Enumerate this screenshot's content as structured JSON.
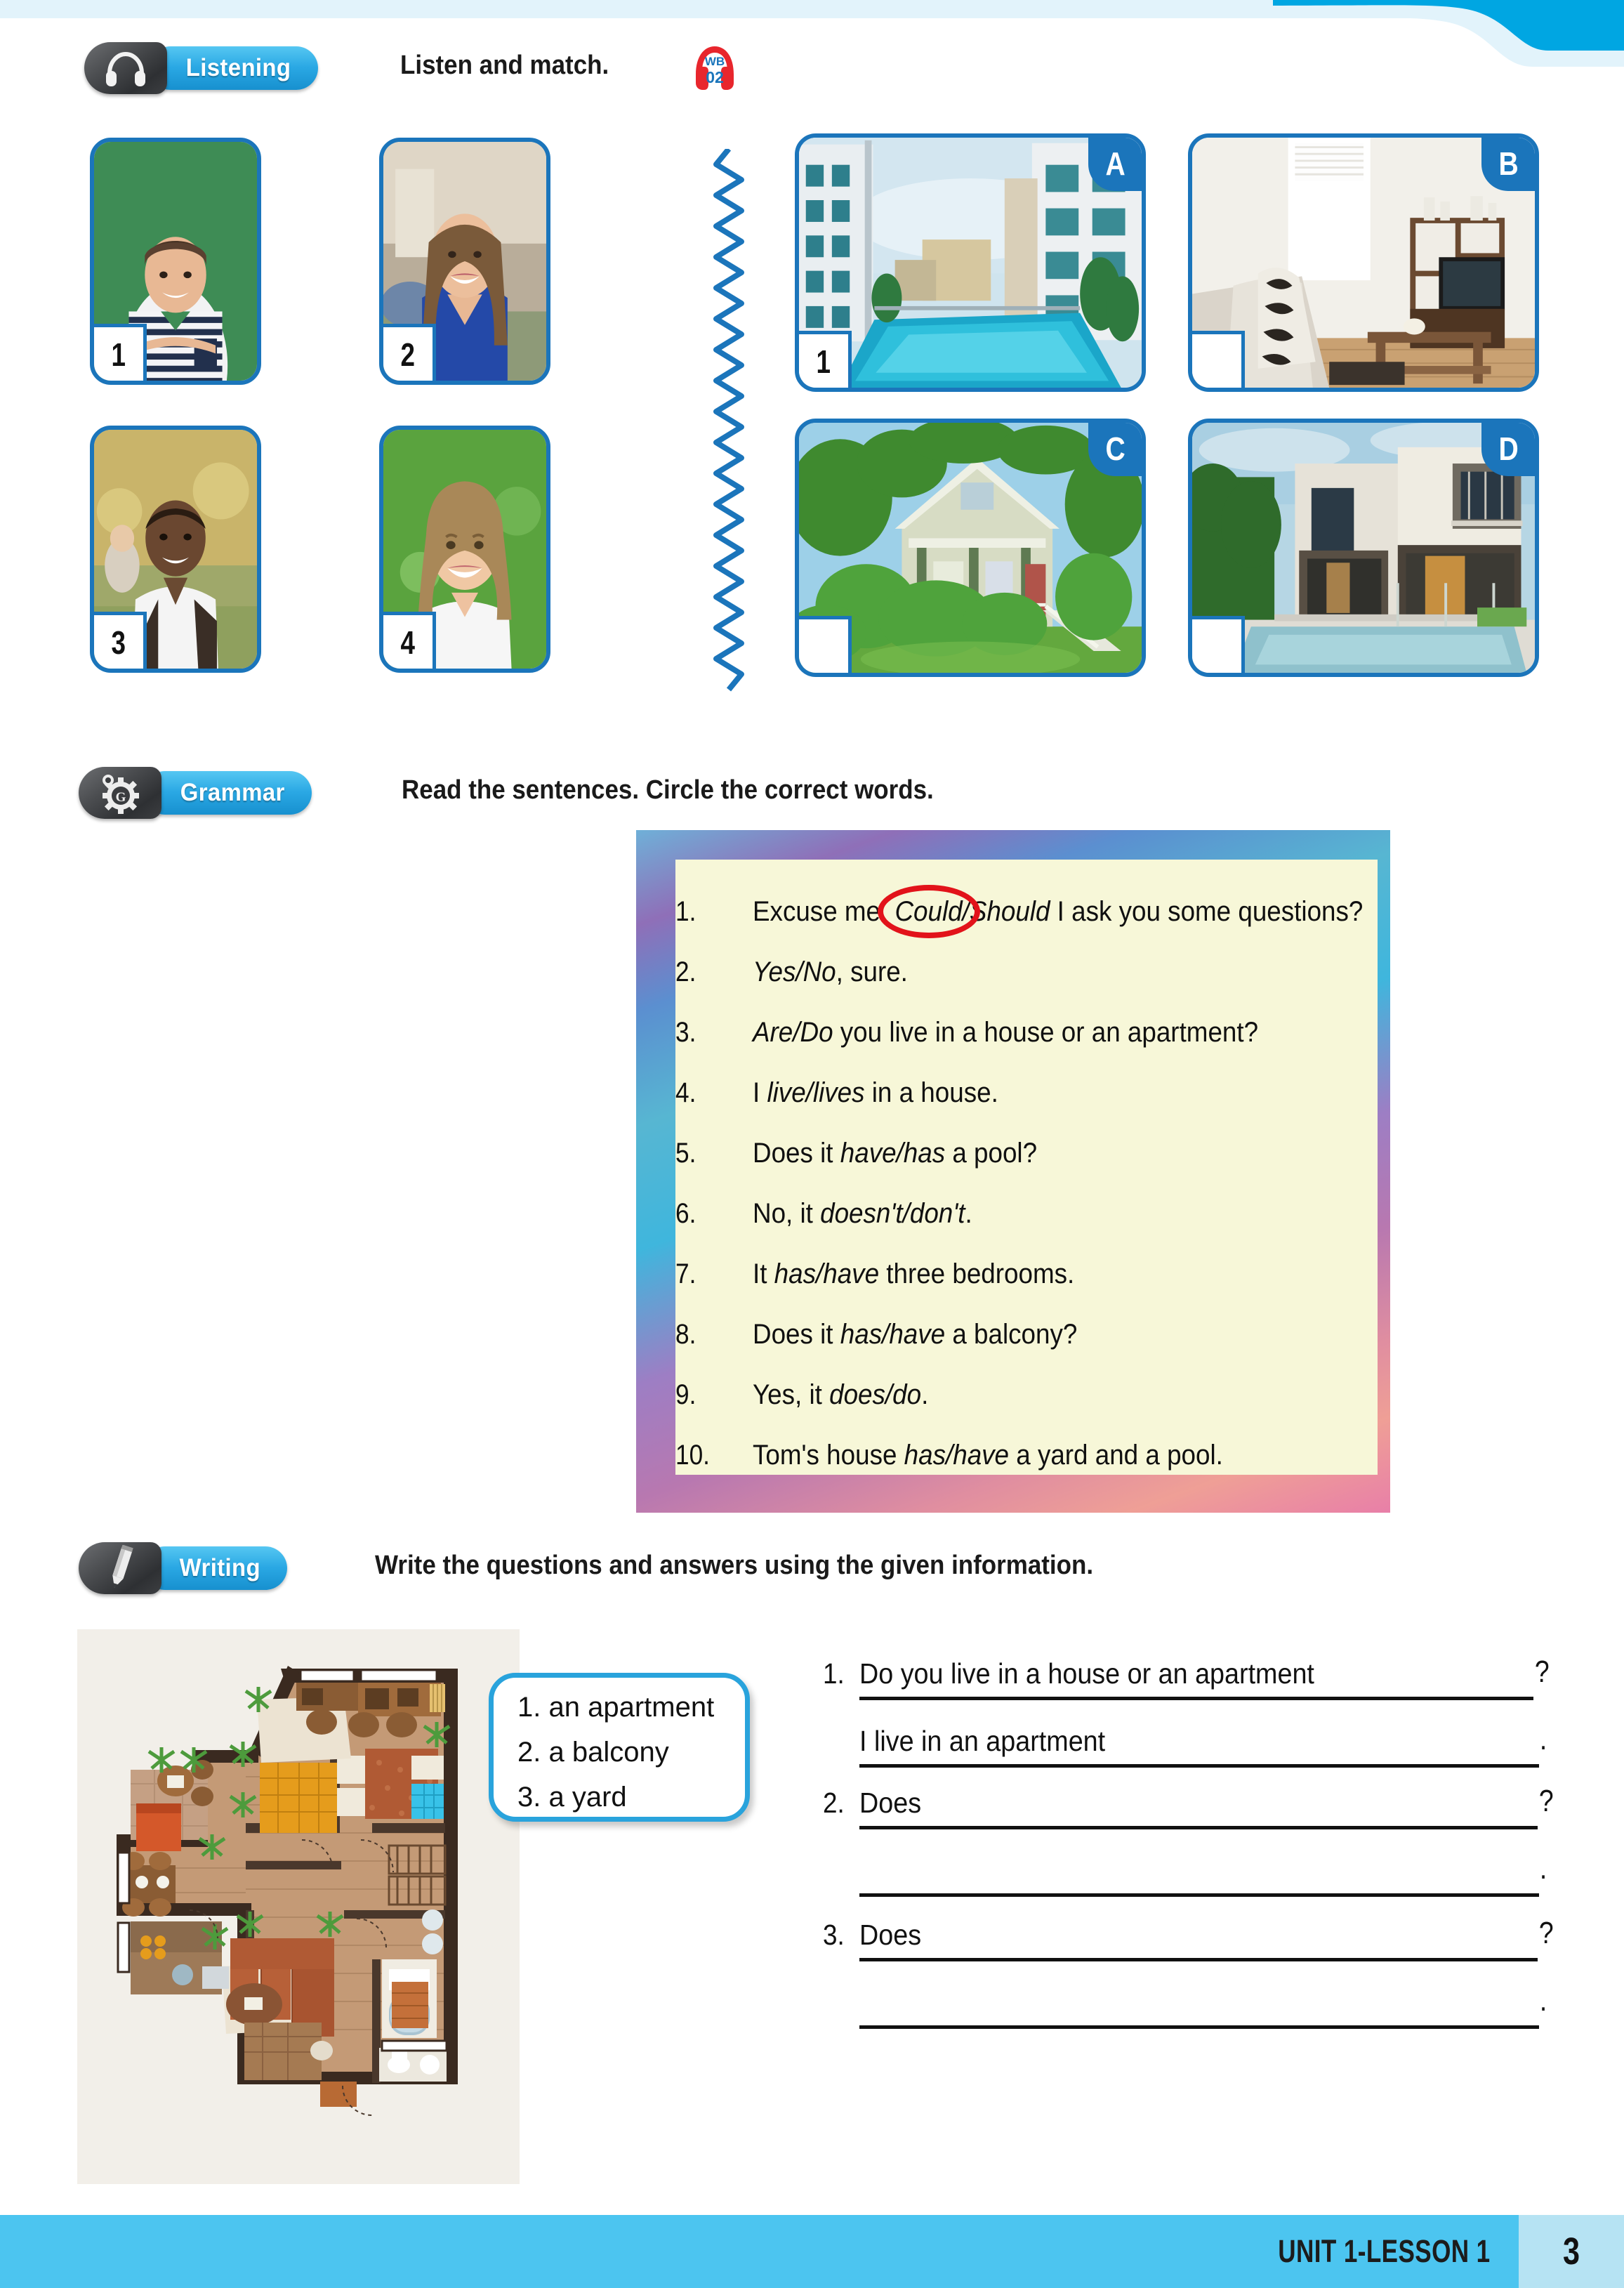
{
  "page": {
    "number": "3",
    "unit_label": "UNIT 1-LESSON 1"
  },
  "sections": {
    "listening": {
      "tab_label": "Listening",
      "tab_icon": "headphones-icon",
      "instruction": "Listen and match.",
      "audio_badge": {
        "line1": "WB",
        "line2": "02",
        "icon": "headphones-audio-icon"
      },
      "people": [
        {
          "number": "1",
          "photo_alt": "teenage boy in striped shirt on green background"
        },
        {
          "number": "2",
          "photo_alt": "girl with long brown hair in blue polo shirt"
        },
        {
          "number": "3",
          "photo_alt": "boy with backpack in white polo shirt outdoors"
        },
        {
          "number": "4",
          "photo_alt": "smiling girl in white t-shirt on green background"
        }
      ],
      "homes": [
        {
          "letter": "A",
          "answer": "1",
          "photo_alt": "apartment building with swimming pool"
        },
        {
          "letter": "B",
          "answer": "",
          "photo_alt": "living room interior with sofa and tv"
        },
        {
          "letter": "C",
          "answer": "",
          "photo_alt": "green wooden house with porch and yard"
        },
        {
          "letter": "D",
          "answer": "",
          "photo_alt": "modern white house with pool and balcony"
        }
      ]
    },
    "grammar": {
      "tab_label": "Grammar",
      "tab_icon": "gear-icon",
      "instruction": "Read the sentences. Circle the correct words.",
      "circled_word": "Could",
      "sentences": [
        {
          "num": "1.",
          "pre": "Excuse me. ",
          "choice": "Could/Should",
          "post": " I ask you some questions?"
        },
        {
          "num": "2.",
          "pre": "",
          "choice": "Yes/No",
          "post": ", sure."
        },
        {
          "num": "3.",
          "pre": "",
          "choice": "Are/Do",
          "post": " you live in a house or an apartment?"
        },
        {
          "num": "4.",
          "pre": "I ",
          "choice": "live/lives",
          "post": " in a house."
        },
        {
          "num": "5.",
          "pre": "Does it ",
          "choice": "have/has",
          "post": " a pool?"
        },
        {
          "num": "6.",
          "pre": "No, it ",
          "choice": "doesn't/don't",
          "post": "."
        },
        {
          "num": "7.",
          "pre": "It ",
          "choice": "has/have",
          "post": " three bedrooms."
        },
        {
          "num": "8.",
          "pre": "Does it ",
          "choice": "has/have",
          "post": " a balcony?"
        },
        {
          "num": "9.",
          "pre": "Yes, it ",
          "choice": "does/do",
          "post": "."
        },
        {
          "num": "10.",
          "pre": "Tom's house ",
          "choice": "has/have",
          "post": " a yard and a pool."
        }
      ]
    },
    "writing": {
      "tab_label": "Writing",
      "tab_icon": "pencil-icon",
      "instruction": "Write the questions and answers using the given information.",
      "floorplan_alt": "apartment floor plan with furniture",
      "word_bank": [
        "1. an apartment",
        "2. a balcony",
        "3. a yard"
      ],
      "items": [
        {
          "num": "1.",
          "question_text": "Do you live in a house or an apartment",
          "question_end": "?",
          "answer_text": "I live in an apartment",
          "answer_end": "."
        },
        {
          "num": "2.",
          "question_text": "Does",
          "question_end": "?",
          "answer_text": "",
          "answer_end": "."
        },
        {
          "num": "3.",
          "question_text": "Does",
          "question_end": "?",
          "answer_text": "",
          "answer_end": "."
        }
      ]
    }
  },
  "colors": {
    "brand_blue": "#1b75bb",
    "tab_blue": "#2aa8e4",
    "footer_blue": "#4cc5f0",
    "footer_page_blue": "#b6e3f3",
    "grammar_paper": "#f7f7d8",
    "circle_red": "#e2131a"
  }
}
